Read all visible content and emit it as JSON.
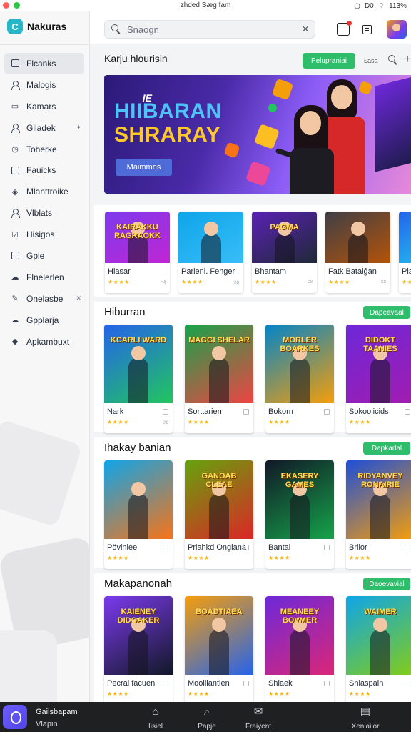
{
  "status_bar": {
    "title": "zhded Sæg fam",
    "battery": "113%",
    "indicator": "D0"
  },
  "app": {
    "name": "Nakuras",
    "logo_glyph": "C"
  },
  "sidebar": {
    "items": [
      {
        "label": "Flcanks",
        "icon": "box-icon",
        "active": true
      },
      {
        "label": "Malogis",
        "icon": "person-icon"
      },
      {
        "label": "Kamars",
        "icon": "card-icon"
      },
      {
        "label": "Giladek",
        "icon": "person-icon",
        "trail": "✦"
      },
      {
        "label": "Toherke",
        "icon": "clock-icon"
      },
      {
        "label": "Fauicks",
        "icon": "box-icon"
      },
      {
        "label": "Mlanttroike",
        "icon": "shield-icon"
      },
      {
        "label": "Vlblats",
        "icon": "person-icon"
      },
      {
        "label": "Hisigos",
        "icon": "check-box-icon"
      },
      {
        "label": "Gple",
        "icon": "box-icon"
      },
      {
        "label": "Flnelerlen",
        "icon": "cloud-icon"
      },
      {
        "label": "Onelasbe",
        "icon": "wrench-icon",
        "trail": "✕"
      },
      {
        "label": "Gpplarja",
        "icon": "cloud-icon"
      },
      {
        "label": "Apkambuxt",
        "icon": "tag-icon"
      }
    ]
  },
  "topbar": {
    "search_placeholder": "Snaogn"
  },
  "hero": {
    "heading": "Karju hlourisin",
    "button": "Pelupraniai",
    "extra": "Łasa",
    "banner": {
      "kicker": "IE",
      "title_line1": "HIIBARAN",
      "title_line2": "SHRARAY",
      "cta": "Maimmns"
    }
  },
  "top_strip": {
    "cards": [
      {
        "name": "Hiasar",
        "art_text": "KAIRAKKU RAGRAOKK",
        "meta": "Ꮋ₰",
        "colors": [
          "#7c3aed",
          "#c026d3"
        ]
      },
      {
        "name": "Parlenl. Fenger",
        "art_text": "",
        "meta": "ℬ8",
        "colors": [
          "#0ea5e9",
          "#38bdf8"
        ]
      },
      {
        "name": "Bhantam",
        "art_text": "PAGMA",
        "meta": "Ꮭ8",
        "colors": [
          "#5b21b6",
          "#1f2937"
        ]
      },
      {
        "name": "Fatk Bataiĝan",
        "art_text": "",
        "meta": "Ꮭ8",
        "colors": [
          "#3f3f46",
          "#b45309"
        ]
      },
      {
        "name": "Pla",
        "art_text": "",
        "meta": "",
        "colors": [
          "#2563eb",
          "#22d3ee"
        ]
      }
    ]
  },
  "sections": [
    {
      "title": "Hiburran",
      "button": "Dapeavaal",
      "cards": [
        {
          "name": "Nark",
          "art_text": "KCARLI WARD",
          "meta": "ℬ8",
          "colors": [
            "#2563eb",
            "#22c55e"
          ]
        },
        {
          "name": "Sorttarien",
          "art_text": "MAGGI SHELAR",
          "meta": "",
          "colors": [
            "#16a34a",
            "#ef4444"
          ]
        },
        {
          "name": "Bokorn",
          "art_text": "MORLER BOARKES",
          "meta": "",
          "colors": [
            "#0284c7",
            "#f59e0b"
          ]
        },
        {
          "name": "Sokoolicids",
          "art_text": "DIDOKT TAANIES",
          "meta": "",
          "colors": [
            "#6d28d9",
            "#a21caf"
          ]
        }
      ]
    },
    {
      "title": "Ihakay banian",
      "button": "Dapkarlal",
      "cards": [
        {
          "name": "Pöviniee",
          "art_text": "",
          "meta": "",
          "colors": [
            "#0ea5e9",
            "#f97316"
          ]
        },
        {
          "name": "Priahkd Onglana",
          "art_text": "GANOAB CLEAE",
          "meta": "",
          "colors": [
            "#65a30d",
            "#dc2626"
          ]
        },
        {
          "name": "Bantal",
          "art_text": "EKASERY GAMES",
          "meta": "",
          "colors": [
            "#111827",
            "#16a34a"
          ]
        },
        {
          "name": "Briior",
          "art_text": "RIDYANVEY RONAIRIE",
          "meta": "",
          "colors": [
            "#1d4ed8",
            "#f59e0b"
          ]
        }
      ]
    },
    {
      "title": "Makapanonah",
      "button": "Daoevavial",
      "cards": [
        {
          "name": "Pecral facuen",
          "art_text": "KAIENEY DIDOAKER",
          "meta": "",
          "colors": [
            "#7c3aed",
            "#111827"
          ]
        },
        {
          "name": "Moolliantien",
          "art_text": "BOADTIAEA",
          "meta": "",
          "colors": [
            "#f59e0b",
            "#2563eb"
          ]
        },
        {
          "name": "Shiaek",
          "art_text": "MEANEEY BOVMER",
          "meta": "",
          "colors": [
            "#6d28d9",
            "#db2777"
          ]
        },
        {
          "name": "Snlaspain",
          "art_text": "WAIMER",
          "meta": "",
          "colors": [
            "#0ea5e9",
            "#84cc16"
          ]
        }
      ]
    }
  ],
  "bottom_bar": {
    "title": "Gailsbapam",
    "subtitle": "Vlapin",
    "tabs": [
      {
        "label": "Iisiel",
        "icon": "home-icon"
      },
      {
        "label": "Papje",
        "icon": "search-icon"
      },
      {
        "label": "Fraiyent",
        "icon": "mail-icon"
      },
      {
        "label": "Xenlailor",
        "icon": "grid-icon"
      }
    ]
  }
}
